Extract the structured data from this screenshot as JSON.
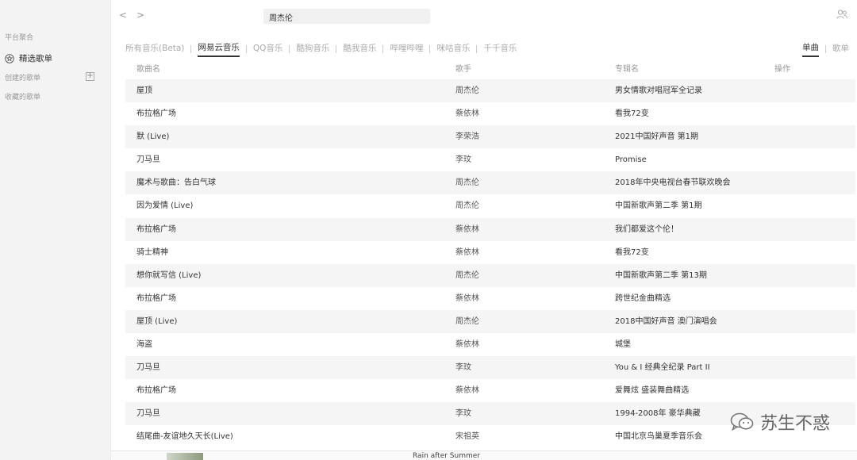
{
  "sidebar": {
    "section_platform": "平台聚合",
    "featured_label": "精选歌单",
    "section_created": "创建的歌单",
    "add_symbol": "+",
    "section_collected": "收藏的歌单"
  },
  "topbar": {
    "back": "<",
    "forward": ">",
    "search_value": "周杰伦"
  },
  "tabs": [
    {
      "label": "所有音乐(Beta)",
      "active": false
    },
    {
      "label": "网易云音乐",
      "active": true
    },
    {
      "label": "QQ音乐",
      "active": false
    },
    {
      "label": "酷狗音乐",
      "active": false
    },
    {
      "label": "酷我音乐",
      "active": false
    },
    {
      "label": "哔哩哔哩",
      "active": false
    },
    {
      "label": "咪咕音乐",
      "active": false
    },
    {
      "label": "千千音乐",
      "active": false
    }
  ],
  "mode_tabs": {
    "single": "单曲",
    "playlist": "歌单"
  },
  "table": {
    "headers": {
      "song": "歌曲名",
      "artist": "歌手",
      "album": "专辑名",
      "action": "操作"
    },
    "rows": [
      {
        "song": "屋顶",
        "artist": "周杰伦",
        "album": "男女情歌对唱冠军全记录"
      },
      {
        "song": "布拉格广场",
        "artist": "蔡依林",
        "album": "看我72变"
      },
      {
        "song": "默 (Live)",
        "artist": "李荣浩",
        "album": "2021中国好声音 第1期"
      },
      {
        "song": "刀马旦",
        "artist": "李玟",
        "album": "Promise"
      },
      {
        "song": "魔术与歌曲：告白气球",
        "artist": "周杰伦",
        "album": "2018年中央电视台春节联欢晚会"
      },
      {
        "song": "因为爱情 (Live)",
        "artist": "周杰伦",
        "album": "中国新歌声第二季 第1期"
      },
      {
        "song": "布拉格广场",
        "artist": "蔡依林",
        "album": "我们都爱这个伦！"
      },
      {
        "song": "骑士精神",
        "artist": "蔡依林",
        "album": "看我72变"
      },
      {
        "song": "想你就写信 (Live)",
        "artist": "周杰伦",
        "album": "中国新歌声第二季 第13期"
      },
      {
        "song": "布拉格广场",
        "artist": "蔡依林",
        "album": "跨世纪金曲精选"
      },
      {
        "song": "屋顶 (Live)",
        "artist": "周杰伦",
        "album": "2018中国好声音 澳门演唱会"
      },
      {
        "song": "海盗",
        "artist": "蔡依林",
        "album": "城堡"
      },
      {
        "song": "刀马旦",
        "artist": "李玟",
        "album": "You & I 经典全纪录 Part II"
      },
      {
        "song": "布拉格广场",
        "artist": "蔡依林",
        "album": "爱舞炫 盛装舞曲精选"
      },
      {
        "song": "刀马旦",
        "artist": "李玟",
        "album": "1994-2008年 豪华典藏"
      },
      {
        "song": "结尾曲-友谊地久天长(Live)",
        "artist": "宋祖英",
        "album": "中国北京鸟巢夏季音乐会"
      }
    ]
  },
  "player": {
    "title": "Rain after Summer"
  },
  "watermark": {
    "text": "苏生不惑"
  }
}
